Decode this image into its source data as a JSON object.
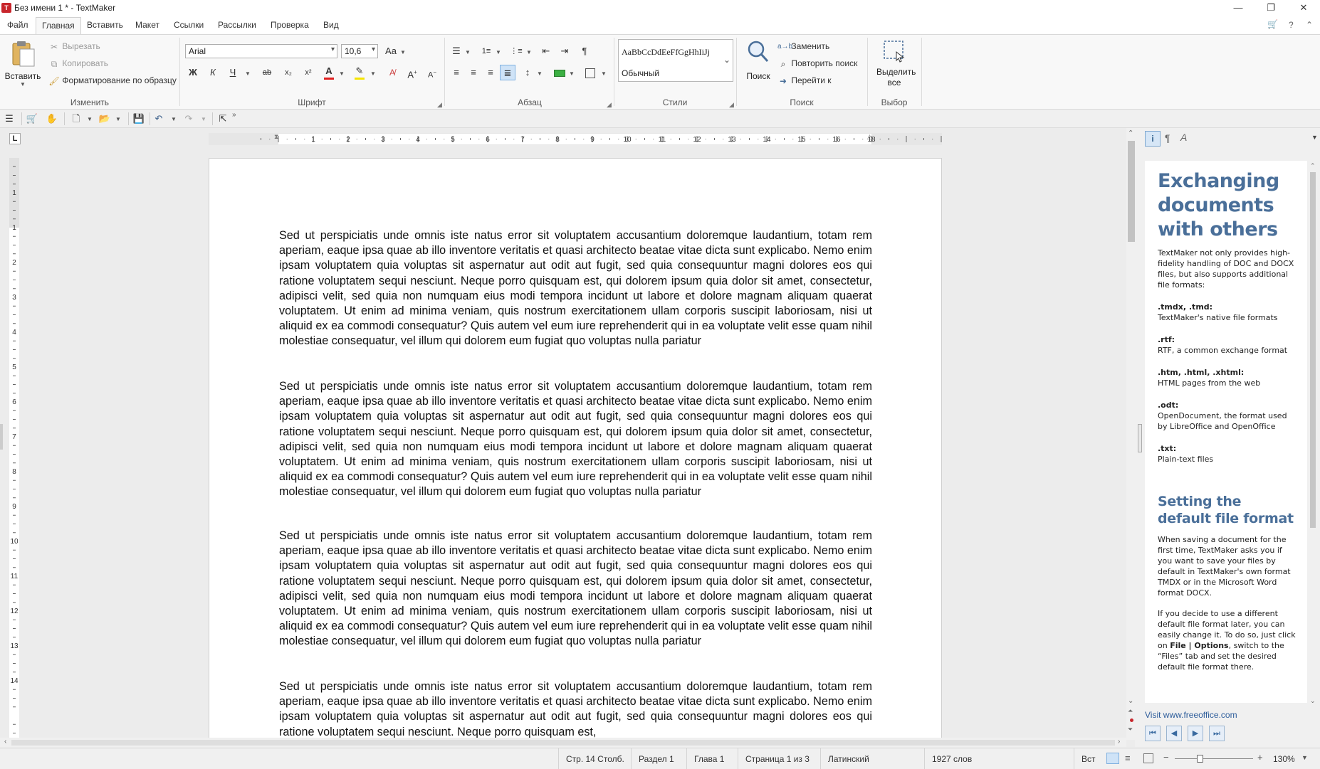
{
  "window": {
    "title": "Без имени 1 * - TextMaker",
    "app_icon_text": "T",
    "minimize": "—",
    "restore": "❐",
    "close": "✕"
  },
  "menu": {
    "items": [
      "Файл",
      "Главная",
      "Вставить",
      "Макет",
      "Ссылки",
      "Рассылки",
      "Проверка",
      "Вид"
    ],
    "active": "Главная",
    "right_icons": [
      "cart-icon",
      "help-icon",
      "chevron-up-icon"
    ],
    "help_glyph": "?",
    "cart_glyph": "🛒",
    "collapse_glyph": "⌃"
  },
  "ribbon": {
    "edit": {
      "paste_label": "Вставить",
      "cut_label": "Вырезать",
      "copy_label": "Копировать",
      "format_painter_label": "Форматирование по образцу",
      "group_label": "Изменить"
    },
    "font": {
      "font_name": "Arial",
      "font_size": "10,6",
      "bold": "Ж",
      "italic": "К",
      "underline": "Ч",
      "strike": "ab",
      "subscript": "x₂",
      "superscript": "x²",
      "font_color_glyph": "A",
      "group_label": "Шрифт"
    },
    "paragraph": {
      "pilcrow": "¶",
      "group_label": "Абзац"
    },
    "styles": {
      "preview_text": "AaBbCcDdEeFfGgHhIiJj",
      "style_name": "Обычный",
      "group_label": "Стили"
    },
    "search": {
      "search_label": "Поиск",
      "replace_label": "Заменить",
      "repeat_label": "Повторить поиск",
      "goto_label": "Перейти к",
      "group_label": "Поиск"
    },
    "selection": {
      "select_all_label": "Выделить все",
      "group_label": "Выбор"
    }
  },
  "colors": {
    "accent_blue": "#4a6f99",
    "font_color_bar": "#e02020",
    "highlight_bar": "#f5e400",
    "shading_bar": "#3cb043",
    "app_red": "#c8262c"
  },
  "ruler": {
    "h_numbers": [
      "1",
      "2",
      "3",
      "4",
      "5",
      "6",
      "7",
      "8",
      "9",
      "10",
      "11",
      "12",
      "13",
      "14",
      "15",
      "16",
      "18"
    ],
    "v_numbers": [
      "1",
      "1",
      "2",
      "3",
      "4",
      "5",
      "6",
      "7",
      "8",
      "9",
      "10",
      "11",
      "12",
      "13",
      "14"
    ],
    "corner_tab": "L"
  },
  "document": {
    "paragraphs": [
      "Sed ut perspiciatis unde omnis iste natus error sit voluptatem accusantium doloremque laudantium, totam rem aperiam, eaque ipsa quae ab illo inventore veritatis et quasi architecto beatae vitae dicta sunt explicabo. Nemo enim ipsam voluptatem quia voluptas sit aspernatur aut odit aut fugit, sed quia consequuntur magni dolores eos qui ratione voluptatem sequi nesciunt. Neque porro quisquam est, qui dolorem ipsum quia dolor sit amet, consectetur, adipisci velit, sed quia non numquam eius modi tempora incidunt ut labore et dolore magnam aliquam quaerat voluptatem. Ut enim ad minima veniam, quis nostrum exercitationem ullam corporis suscipit laboriosam, nisi ut aliquid ex ea commodi consequatur? Quis autem vel eum iure reprehenderit qui in ea voluptate velit esse quam nihil molestiae consequatur, vel illum qui dolorem eum fugiat quo voluptas nulla pariatur",
      "Sed ut perspiciatis unde omnis iste natus error sit voluptatem accusantium doloremque laudantium, totam rem aperiam, eaque ipsa quae ab illo inventore veritatis et quasi architecto beatae vitae dicta sunt explicabo. Nemo enim ipsam voluptatem quia voluptas sit aspernatur aut odit aut fugit, sed quia consequuntur magni dolores eos qui ratione voluptatem sequi nesciunt. Neque porro quisquam est, qui dolorem ipsum quia dolor sit amet, consectetur, adipisci velit, sed quia non numquam eius modi tempora incidunt ut labore et dolore magnam aliquam quaerat voluptatem. Ut enim ad minima veniam, quis nostrum exercitationem ullam corporis suscipit laboriosam, nisi ut aliquid ex ea commodi consequatur? Quis autem vel eum iure reprehenderit qui in ea voluptate velit esse quam nihil molestiae consequatur, vel illum qui dolorem eum fugiat quo voluptas nulla pariatur",
      "Sed ut perspiciatis unde omnis iste natus error sit voluptatem accusantium doloremque laudantium, totam rem aperiam, eaque ipsa quae ab illo inventore veritatis et quasi architecto beatae vitae dicta sunt explicabo. Nemo enim ipsam voluptatem quia voluptas sit aspernatur aut odit aut fugit, sed quia consequuntur magni dolores eos qui ratione voluptatem sequi nesciunt. Neque porro quisquam est, qui dolorem ipsum quia dolor sit amet, consectetur, adipisci velit, sed quia non numquam eius modi tempora incidunt ut labore et dolore magnam aliquam quaerat voluptatem. Ut enim ad minima veniam, quis nostrum exercitationem ullam corporis suscipit laboriosam, nisi ut aliquid ex ea commodi consequatur? Quis autem vel eum iure reprehenderit qui in ea voluptate velit esse quam nihil molestiae consequatur, vel illum qui dolorem eum fugiat quo voluptas nulla pariatur",
      "Sed ut perspiciatis unde omnis iste natus error sit voluptatem accusantium doloremque laudantium, totam rem aperiam, eaque ipsa quae ab illo inventore veritatis et quasi architecto beatae vitae dicta sunt explicabo. Nemo enim ipsam voluptatem quia voluptas sit aspernatur aut odit aut fugit, sed quia consequuntur magni dolores eos qui ratione voluptatem sequi nesciunt. Neque porro quisquam est,"
    ]
  },
  "sidebar": {
    "tab_icons": [
      "info-icon",
      "pilcrow-icon",
      "character-format-icon"
    ],
    "heading1": "Exchanging documents with others",
    "intro": "TextMaker not only provides high-fidelity handling of DOC and DOCX files, but also supports additional file formats:",
    "formats": [
      {
        "ext": ".tmdx, .tmd:",
        "desc": "TextMaker's native file formats"
      },
      {
        "ext": ".rtf:",
        "desc": "RTF, a common exchange format"
      },
      {
        "ext": ".htm, .html, .xhtml:",
        "desc": "HTML pages from the web"
      },
      {
        "ext": ".odt:",
        "desc": "OpenDocument, the format used by LibreOffice and OpenOffice"
      },
      {
        "ext": ".txt:",
        "desc": "Plain-text files"
      }
    ],
    "heading2": "Setting the default file format",
    "para1": "When saving a document for the first time, TextMaker asks you if you want to save your files by default in TextMaker's own format TMDX or in the Microsoft Word format DOCX.",
    "para2_a": "If you decide to use a different default file format later, you can easily change it. To do so, just click on ",
    "para2_bold": "File | Options",
    "para2_b": ", switch to the “Files” tab and set the desired default file format there.",
    "link": "Visit www.freeoffice.com"
  },
  "status": {
    "position": "Стр. 14 Столб.",
    "section": "Раздел 1",
    "chapter": "Глава 1",
    "page": "Страница 1 из 3",
    "language": "Латинский",
    "words": "1927 слов",
    "mode": "Вст",
    "zoom": "130%",
    "zoom_minus": "−",
    "zoom_plus": "+",
    "zoom_level": 0.33
  }
}
